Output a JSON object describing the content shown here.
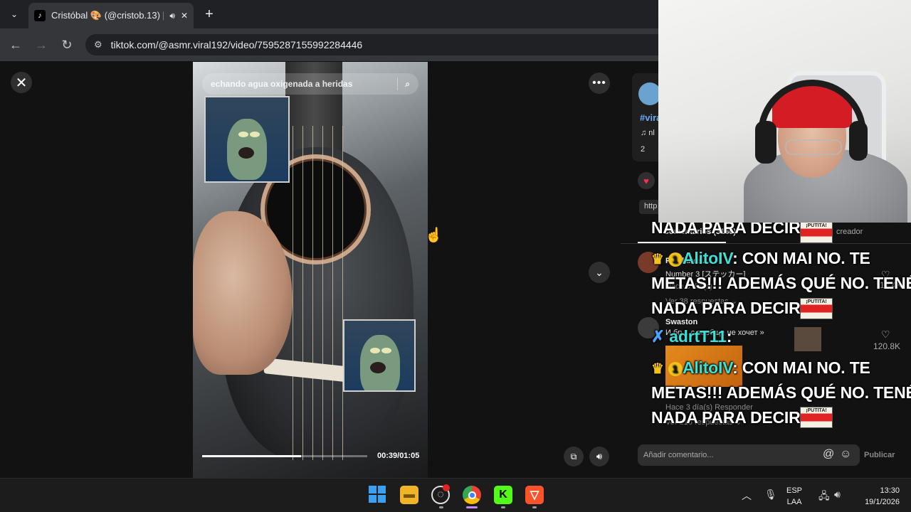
{
  "browser": {
    "tab_title": "Cristóbal 🎨 (@cristob.13) |",
    "url": "tiktok.com/@asmr.viral192/video/7595287155992284446"
  },
  "video": {
    "search_placeholder": "echando agua oxigenada a heridas",
    "time": "00:39/01:05",
    "progress": 0.6
  },
  "panel": {
    "hashtag": "#vira",
    "music": "♫  nl",
    "stat": "2",
    "link": "http",
    "tab_comments": "Comentarios (3136)",
    "tab_creator": "creador"
  },
  "comments": [
    {
      "user": "Pinelands...",
      "text": "Number 3 [ステッカー]",
      "meta": "Hace 3 día(s)",
      "replies": "Ver 38 respuestas ⌄",
      "count": "12.4K"
    },
    {
      "user": "Swaston",
      "text": "И бр... с вообще не хочет »",
      "meta": "Hace 3 día(s)   Responder",
      "replies": "Ver 216 respuestas ⌄",
      "count": "120.8K"
    }
  ],
  "chat": {
    "line1": "NADA PARA DECIR!!!",
    "user_a": "AlitoIV",
    "msg_a_1": ": CON MAI NO. TE",
    "msg_a_2": "METAS!!! ADEMÁS QUÉ NO. TENÉS",
    "msg_a_3": "NADA PARA DECIR!!!",
    "user_b": "adrtT11",
    "msg_b": ":",
    "rank": "1",
    "emote_label": "¡PUTITA!"
  },
  "composer": {
    "placeholder": "Añadir comentario...",
    "publish": "Publicar"
  },
  "taskbar": {
    "lang_1": "ESP",
    "lang_2": "LAA",
    "time": "13:30",
    "date": "19/1/2026"
  }
}
